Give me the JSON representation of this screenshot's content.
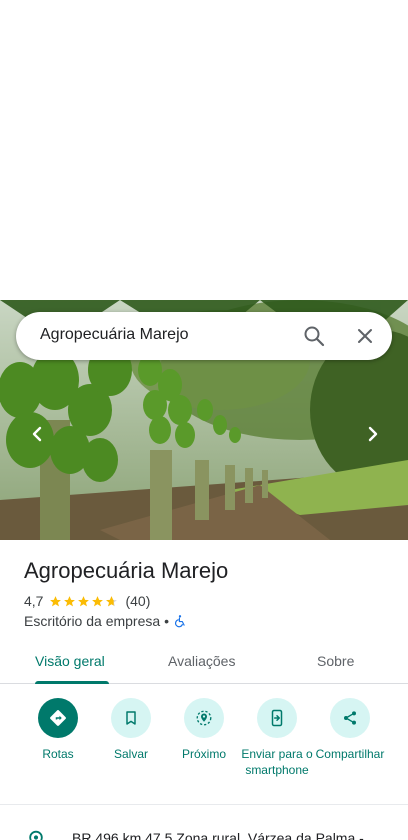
{
  "search": {
    "query": "Agropecuária Marejo"
  },
  "place": {
    "name": "Agropecuária Marejo",
    "rating": "4,7",
    "stars": 4.7,
    "review_count": "(40)",
    "category": "Escritório da empresa",
    "separator": "•"
  },
  "tabs": [
    {
      "label": "Visão geral",
      "active": true
    },
    {
      "label": "Avaliações",
      "active": false
    },
    {
      "label": "Sobre",
      "active": false
    }
  ],
  "actions": [
    {
      "label": "Rotas",
      "icon": "directions-icon"
    },
    {
      "label": "Salvar",
      "icon": "bookmark-icon"
    },
    {
      "label": "Próximo",
      "icon": "nearby-icon"
    },
    {
      "label": "Enviar para o smartphone",
      "icon": "send-to-phone-icon"
    },
    {
      "label": "Compartilhar",
      "icon": "share-icon"
    }
  ],
  "address": {
    "text": "BR 496 km 47,5 Zona rural, Várzea da Palma -"
  },
  "colors": {
    "accent": "#00796b",
    "chip_bg": "#d6f5f3",
    "star": "#fbbc04"
  }
}
